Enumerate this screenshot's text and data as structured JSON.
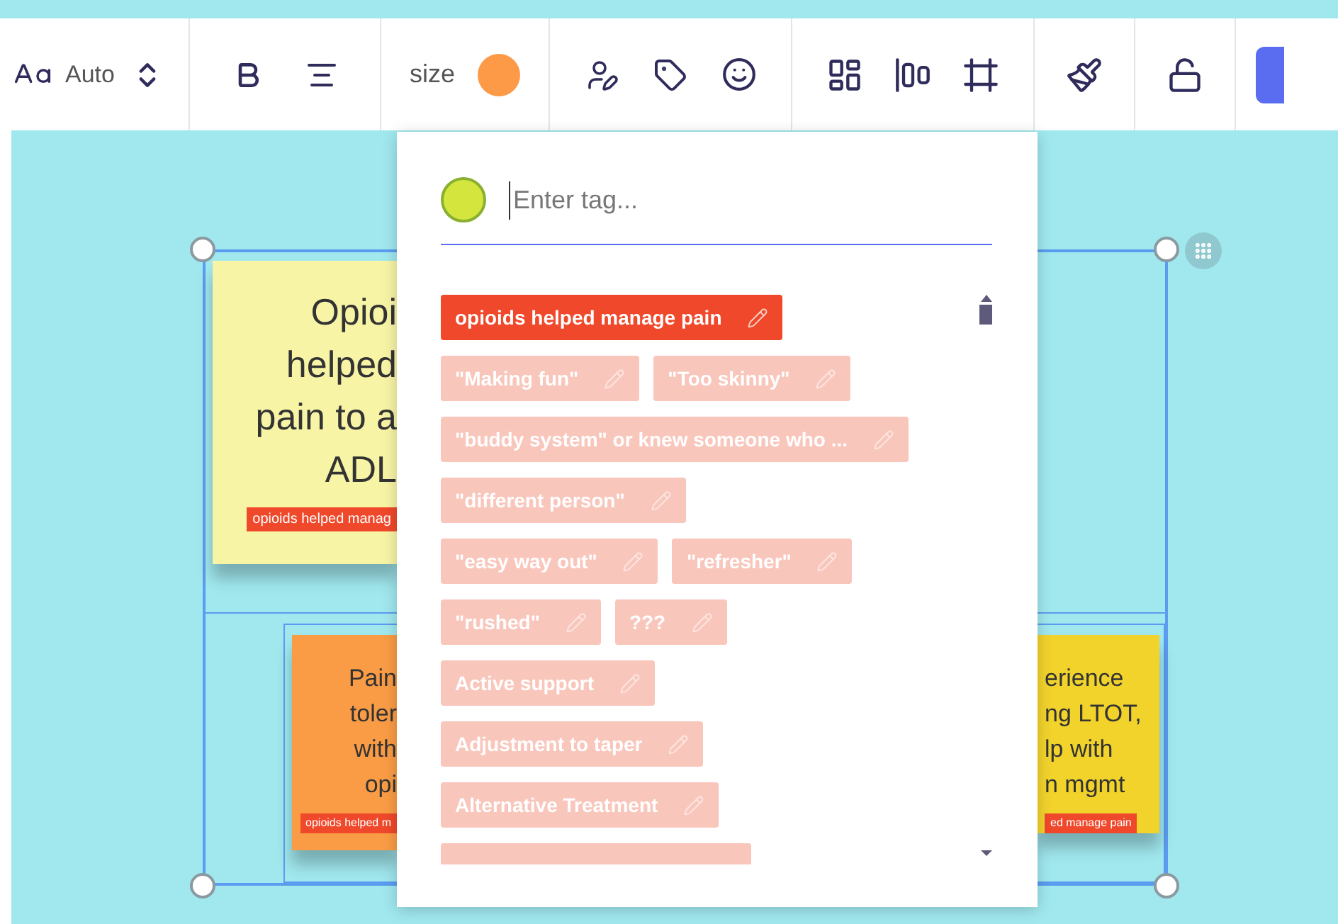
{
  "toolbar": {
    "font_size": "Auto",
    "size_label": "size",
    "color": "#fd9a48"
  },
  "notes": [
    {
      "color": "#f8f4a6",
      "lines": [
        "Opioi",
        "helped",
        "pain to a",
        "ADL"
      ],
      "tag": "opioids helped manag"
    },
    {
      "color": "#fa9c45",
      "lines": [
        "Pain",
        "toler",
        "with",
        "opi"
      ],
      "tag": "opioids helped m"
    },
    {
      "color": "#f2d32c",
      "lines": [
        "erience",
        "ng LTOT,",
        "lp with",
        "n mgmt"
      ],
      "tag": "ed manage pain"
    }
  ],
  "tag_popup": {
    "color": "#d4e63e",
    "placeholder": "Enter tag...",
    "tag_rows": [
      [
        {
          "label": "opioids helped manage pain",
          "selected": true
        }
      ],
      [
        {
          "label": "\"Making fun\"",
          "selected": false
        },
        {
          "label": "\"Too skinny\"",
          "selected": false
        }
      ],
      [
        {
          "label": "\"buddy system\" or knew someone who ...",
          "selected": false
        }
      ],
      [
        {
          "label": "\"different person\"",
          "selected": false
        }
      ],
      [
        {
          "label": "\"easy way out\"",
          "selected": false
        },
        {
          "label": "\"refresher\"",
          "selected": false
        }
      ],
      [
        {
          "label": "\"rushed\"",
          "selected": false
        },
        {
          "label": "???",
          "selected": false
        }
      ],
      [
        {
          "label": "Active support",
          "selected": false
        }
      ],
      [
        {
          "label": "Adjustment to taper",
          "selected": false
        }
      ],
      [
        {
          "label": "Alternative Treatment",
          "selected": false
        }
      ]
    ]
  }
}
